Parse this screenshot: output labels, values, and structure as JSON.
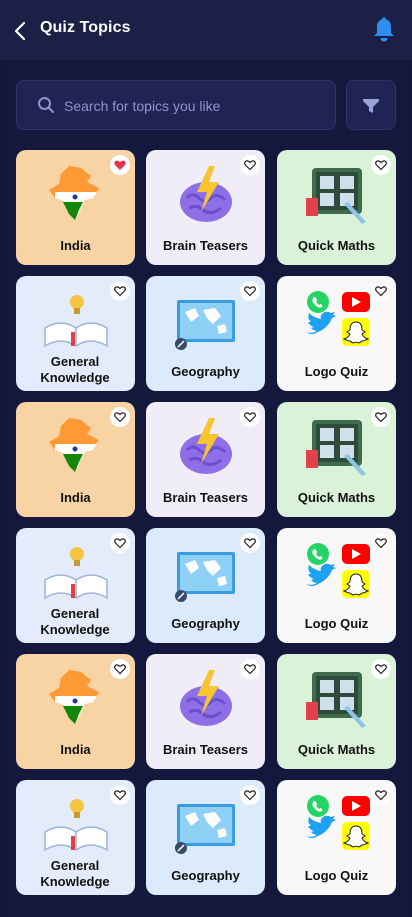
{
  "header": {
    "title": "Quiz Topics",
    "back_icon": "chevron-left-icon",
    "bell_icon": "bell-icon",
    "accent_color": "#1e90ff"
  },
  "search": {
    "placeholder": "Search for topics you like",
    "icon": "search-icon"
  },
  "filter": {
    "icon": "filter-icon"
  },
  "topics": [
    {
      "label": "India",
      "kind": "india",
      "favorite": true
    },
    {
      "label": "Brain Teasers",
      "kind": "brain",
      "favorite": false
    },
    {
      "label": "Quick Maths",
      "kind": "maths",
      "favorite": false
    },
    {
      "label": "General Knowledge",
      "kind": "gk",
      "favorite": false
    },
    {
      "label": "Geography",
      "kind": "geo",
      "favorite": false
    },
    {
      "label": "Logo Quiz",
      "kind": "logo",
      "favorite": false
    },
    {
      "label": "India",
      "kind": "india",
      "favorite": false
    },
    {
      "label": "Brain Teasers",
      "kind": "brain",
      "favorite": false
    },
    {
      "label": "Quick Maths",
      "kind": "maths",
      "favorite": false
    },
    {
      "label": "General Knowledge",
      "kind": "gk",
      "favorite": false
    },
    {
      "label": "Geography",
      "kind": "geo",
      "favorite": false
    },
    {
      "label": "Logo Quiz",
      "kind": "logo",
      "favorite": false
    },
    {
      "label": "India",
      "kind": "india",
      "favorite": false
    },
    {
      "label": "Brain Teasers",
      "kind": "brain",
      "favorite": false
    },
    {
      "label": "Quick Maths",
      "kind": "maths",
      "favorite": false
    },
    {
      "label": "General Knowledge",
      "kind": "gk",
      "favorite": false
    },
    {
      "label": "Geography",
      "kind": "geo",
      "favorite": false
    },
    {
      "label": "Logo Quiz",
      "kind": "logo",
      "favorite": false
    }
  ]
}
